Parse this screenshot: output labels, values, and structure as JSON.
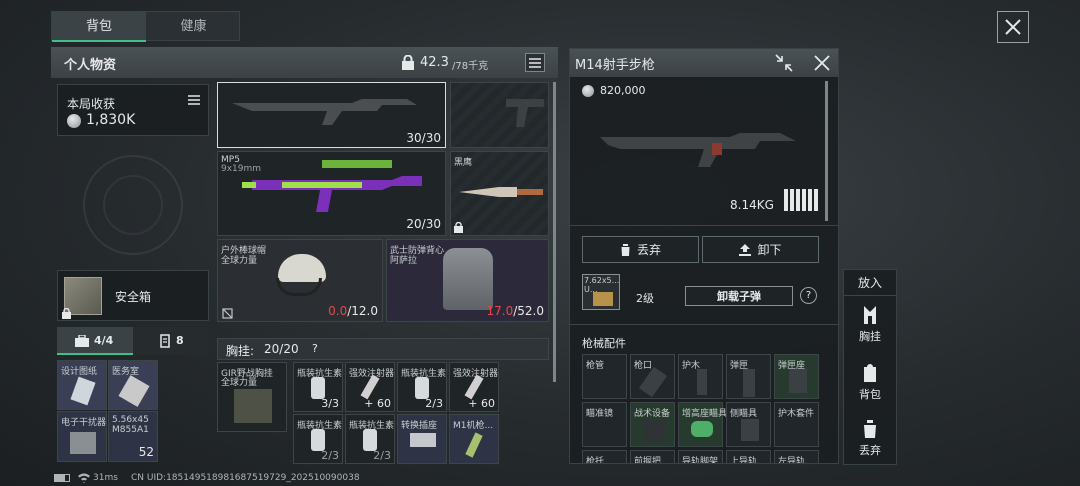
{
  "tabs": {
    "backpack": "背包",
    "health": "健康"
  },
  "personal": {
    "title": "个人物资",
    "weight_value": "42.3",
    "weight_max": "/78千克"
  },
  "harvest": {
    "label": "本局收获",
    "value": "1,830K"
  },
  "safe_box": {
    "label": "安全箱"
  },
  "counters": {
    "tools": "4/4",
    "ammo": "8"
  },
  "pouch_items": [
    {
      "name": "设计图纸"
    },
    {
      "name": "医务室"
    },
    {
      "name": "电子干扰器"
    },
    {
      "name": "5.56x45 M855A1",
      "count": "52"
    }
  ],
  "grid": {
    "rifle_count": "30/30",
    "mp5_name": "MP5",
    "mp5_sub": "9x19mm",
    "mp5_count": "20/30",
    "knife_name": "黑鹰",
    "helmet_name": "户外棒球帽",
    "helmet_sub": "全球力量",
    "helmet_cur": "0.0",
    "helmet_max": "/12.0",
    "vest_name": "武士防弹背心",
    "vest_sub": "阿萨拉",
    "vest_cur": "17.0",
    "vest_max": "/52.0"
  },
  "chest_rig": {
    "label": "胸挂:",
    "value": "20/20",
    "help": "?",
    "rig_name": "GIR野战胸挂",
    "rig_sub": "全球力量",
    "items": [
      {
        "name": "瓶装抗生素",
        "count": "3/3"
      },
      {
        "name": "强效注射器",
        "count": "60"
      },
      {
        "name": "瓶装抗生素",
        "count": "2/3"
      },
      {
        "name": "强效注射器",
        "count": "60"
      },
      {
        "name": "瓶装抗生素",
        "count": "2/3"
      },
      {
        "name": "瓶装抗生素",
        "count": "2/3"
      },
      {
        "name": "转换插座",
        "count": ""
      },
      {
        "name": "M1机枪...",
        "count": ""
      }
    ]
  },
  "detail": {
    "title": "M14射手步枪",
    "price": "820,000",
    "weight": "8.14KG",
    "discard": "丢弃",
    "unload": "卸下",
    "ammo_name": "7.62x5...",
    "ammo_sub": "U...",
    "ammo_level": "2级",
    "unload_ammo": "卸载子弹",
    "help": "?",
    "attachments_title": "枪械配件",
    "attachments_row1": [
      "枪管",
      "枪口",
      "护木",
      "弹匣",
      "弹匣座"
    ],
    "attachments_row2": [
      "瞄准镜",
      "战术设备",
      "增高座瞄具",
      "侧瞄具",
      "护木套件"
    ],
    "attachments_row3": [
      "枪托",
      "前握把",
      "导轨脚架",
      "上导轨",
      "左导轨"
    ]
  },
  "side_actions": {
    "title": "放入",
    "rig": "胸挂",
    "backpack": "背包",
    "discard": "丢弃"
  },
  "status": {
    "ping": "31ms",
    "uid": "CN UID:18514951898168751972​9_202510090038"
  }
}
